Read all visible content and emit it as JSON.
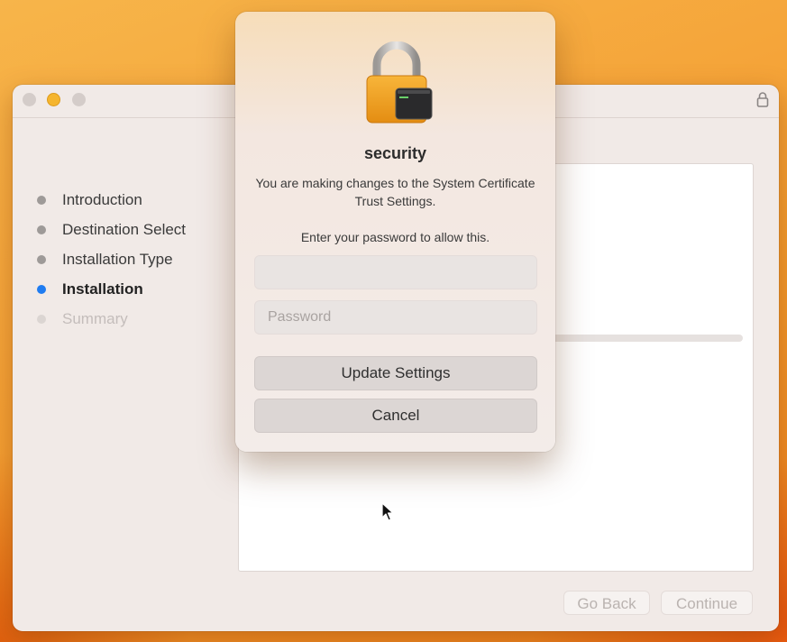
{
  "installer": {
    "steps": [
      {
        "label": "Introduction",
        "state": "done"
      },
      {
        "label": "Destination Select",
        "state": "done"
      },
      {
        "label": "Installation Type",
        "state": "done"
      },
      {
        "label": "Installation",
        "state": "active"
      },
      {
        "label": "Summary",
        "state": "pending"
      }
    ],
    "progress_fraction": 0.07,
    "go_back_label": "Go Back",
    "continue_label": "Continue",
    "icons": {
      "window_lock": "lock-icon"
    }
  },
  "dialog": {
    "app_name": "security",
    "message": "You are making changes to the System Certificate Trust Settings.",
    "prompt": "Enter your password to allow this.",
    "username_value": "",
    "password_placeholder": "Password",
    "update_label": "Update Settings",
    "cancel_label": "Cancel",
    "icon": "lock-terminal-icon"
  },
  "colors": {
    "accent": "#1f7cf1",
    "wallpaper": "#f5a53a",
    "minimize": "#f5b52e"
  }
}
